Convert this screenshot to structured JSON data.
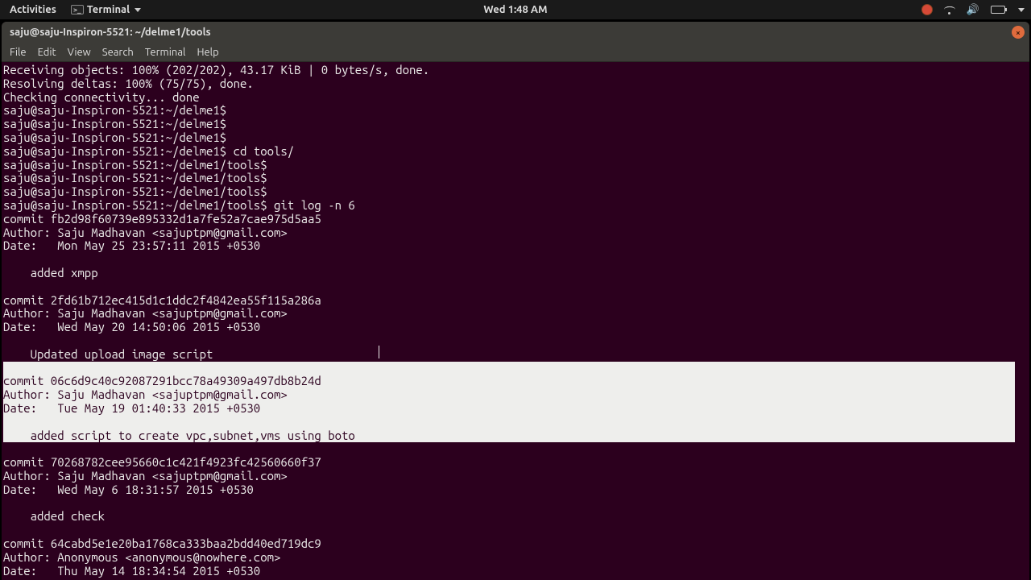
{
  "topbar": {
    "activities": "Activities",
    "terminal_label": "Terminal",
    "clock": "Wed  1:48 AM"
  },
  "window": {
    "title": "saju@saju-Inspiron-5521: ~/delme1/tools",
    "menu": {
      "file": "File",
      "edit": "Edit",
      "view": "View",
      "search": "Search",
      "terminal": "Terminal",
      "help": "Help"
    }
  },
  "prompt_base": "saju@saju-Inspiron-5521:~/delme1",
  "prompt_tools": "saju@saju-Inspiron-5521:~/delme1/tools",
  "terminal_lines_top": [
    "Receiving objects: 100% (202/202), 43.17 KiB | 0 bytes/s, done.",
    "Resolving deltas: 100% (75/75), done.",
    "Checking connectivity... done",
    "saju@saju-Inspiron-5521:~/delme1$",
    "saju@saju-Inspiron-5521:~/delme1$",
    "saju@saju-Inspiron-5521:~/delme1$",
    "saju@saju-Inspiron-5521:~/delme1$ cd tools/",
    "saju@saju-Inspiron-5521:~/delme1/tools$",
    "saju@saju-Inspiron-5521:~/delme1/tools$",
    "saju@saju-Inspiron-5521:~/delme1/tools$",
    "saju@saju-Inspiron-5521:~/delme1/tools$ git log -n 6",
    "commit fb2d98f60739e895332d1a7fe52a7cae975d5aa5",
    "Author: Saju Madhavan <sajuptpm@gmail.com>",
    "Date:   Mon May 25 23:57:11 2015 +0530",
    "",
    "    added xmpp",
    "",
    "commit 2fd61b712ec415d1c1ddc2f4842ea55f115a286a",
    "Author: Saju Madhavan <sajuptpm@gmail.com>",
    "Date:   Wed May 20 14:50:06 2015 +0530",
    "",
    "    Updated upload image script"
  ],
  "terminal_selected": [
    "",
    "commit 06c6d9c40c92087291bcc78a49309a497db8b24d",
    "Author: Saju Madhavan <sajuptpm@gmail.com>",
    "Date:   Tue May 19 01:40:33 2015 +0530",
    "",
    "    added script to create vpc,subnet,vms using boto"
  ],
  "terminal_lines_bottom": [
    "",
    "commit 70268782cee95660c1c421f4923fc42560660f37",
    "Author: Saju Madhavan <sajuptpm@gmail.com>",
    "Date:   Wed May 6 18:31:57 2015 +0530",
    "",
    "    added check",
    "",
    "commit 64cabd5e1e20ba1768ca333baa2bdd40ed719dc9",
    "Author: Anonymous <anonymous@nowhere.com>",
    "Date:   Thu May 14 18:34:54 2015 +0530"
  ]
}
